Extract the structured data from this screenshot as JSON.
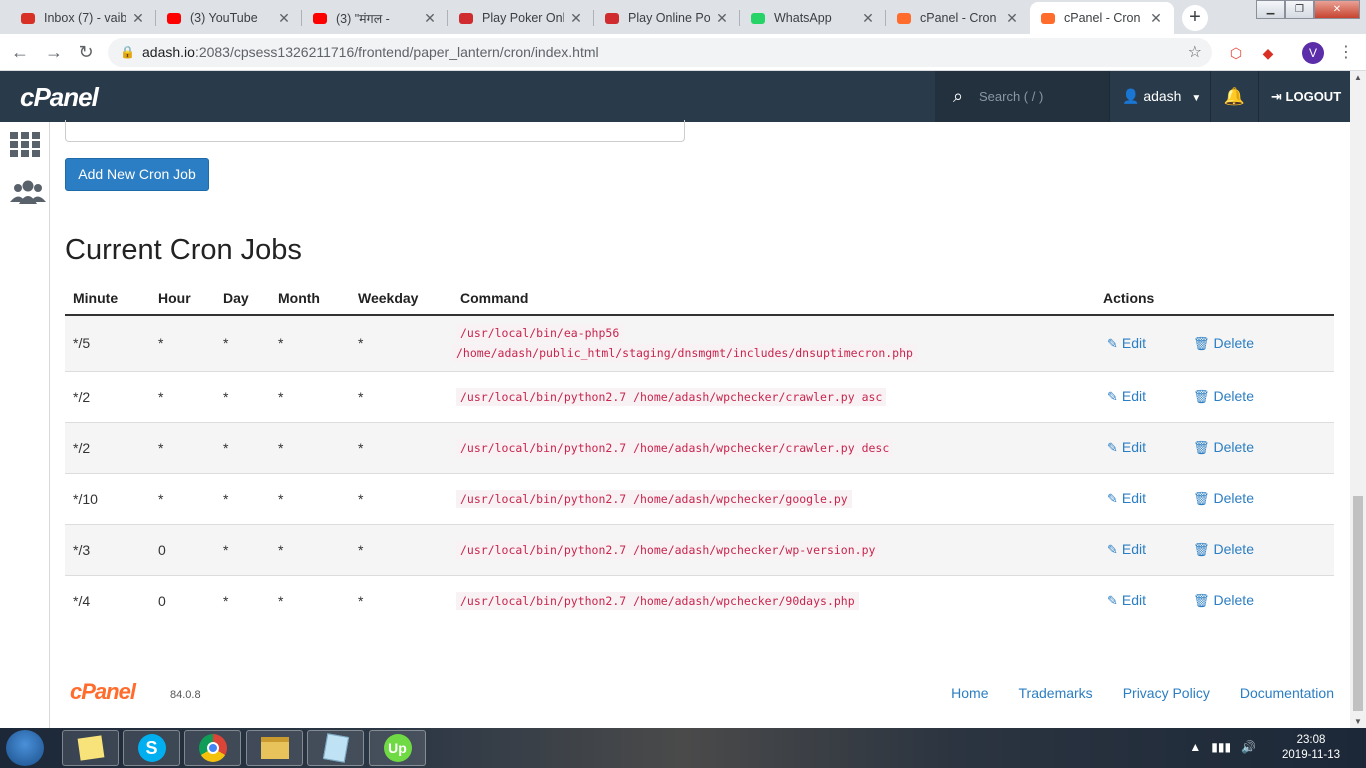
{
  "browser": {
    "tabs": [
      {
        "title": "Inbox (7) - vaib",
        "icon": "gmail-icon",
        "color": "#d93025"
      },
      {
        "title": "(3) YouTube",
        "icon": "youtube-icon",
        "color": "#ff0000"
      },
      {
        "title": "(3) \"मंगल -",
        "icon": "youtube-icon",
        "color": "#ff0000"
      },
      {
        "title": "Play Poker Onli",
        "icon": "poker-icon",
        "color": "#d02c2f"
      },
      {
        "title": "Play Online Pok",
        "icon": "poker-icon",
        "color": "#d02c2f"
      },
      {
        "title": "WhatsApp",
        "icon": "whatsapp-icon",
        "color": "#25d366"
      },
      {
        "title": "cPanel - Cron J",
        "icon": "cpanel-icon",
        "color": "#ff6c2c"
      },
      {
        "title": "cPanel - Cron J",
        "icon": "cpanel-icon",
        "color": "#ff6c2c"
      }
    ],
    "url_host": "adash.io",
    "url_path": ":2083/cpsess1326211716/frontend/paper_lantern/cron/index.html",
    "profile_initial": "V"
  },
  "cpanel": {
    "logo": "cPanel",
    "search_placeholder": "Search ( / )",
    "username": "adash",
    "logout_label": "LOGOUT",
    "accent": "#2b7ec3",
    "topbar_color": "#293a4a"
  },
  "main": {
    "add_button_label": "Add New Cron Job",
    "section_title": "Current Cron Jobs",
    "columns": [
      "Minute",
      "Hour",
      "Day",
      "Month",
      "Weekday",
      "Command",
      "Actions"
    ],
    "edit_label": "Edit",
    "delete_label": "Delete",
    "jobs": [
      {
        "minute": "*/5",
        "hour": "*",
        "day": "*",
        "month": "*",
        "weekday": "*",
        "command_line1": "/usr/local/bin/ea-php56",
        "command_line2": "/home/adash/public_html/staging/dnsmgmt/includes/dnsuptimecron.php"
      },
      {
        "minute": "*/2",
        "hour": "*",
        "day": "*",
        "month": "*",
        "weekday": "*",
        "command_line1": "/usr/local/bin/python2.7 /home/adash/wpchecker/crawler.py asc",
        "command_line2": ""
      },
      {
        "minute": "*/2",
        "hour": "*",
        "day": "*",
        "month": "*",
        "weekday": "*",
        "command_line1": "/usr/local/bin/python2.7 /home/adash/wpchecker/crawler.py desc",
        "command_line2": ""
      },
      {
        "minute": "*/10",
        "hour": "*",
        "day": "*",
        "month": "*",
        "weekday": "*",
        "command_line1": "/usr/local/bin/python2.7 /home/adash/wpchecker/google.py",
        "command_line2": ""
      },
      {
        "minute": "*/3",
        "hour": "0",
        "day": "*",
        "month": "*",
        "weekday": "*",
        "command_line1": "/usr/local/bin/python2.7 /home/adash/wpchecker/wp-version.py",
        "command_line2": ""
      },
      {
        "minute": "*/4",
        "hour": "0",
        "day": "*",
        "month": "*",
        "weekday": "*",
        "command_line1": "/usr/local/bin/python2.7 /home/adash/wpchecker/90days.php",
        "command_line2": ""
      }
    ]
  },
  "footer": {
    "logo": "cPanel",
    "version": "84.0.8",
    "links": [
      "Home",
      "Trademarks",
      "Privacy Policy",
      "Documentation"
    ]
  },
  "taskbar": {
    "time": "23:08",
    "date": "2019-11-13",
    "apps": [
      "sticky-notes-icon",
      "skype-icon",
      "chrome-icon",
      "file-explorer-icon",
      "notepad-icon",
      "upwork-icon"
    ]
  }
}
